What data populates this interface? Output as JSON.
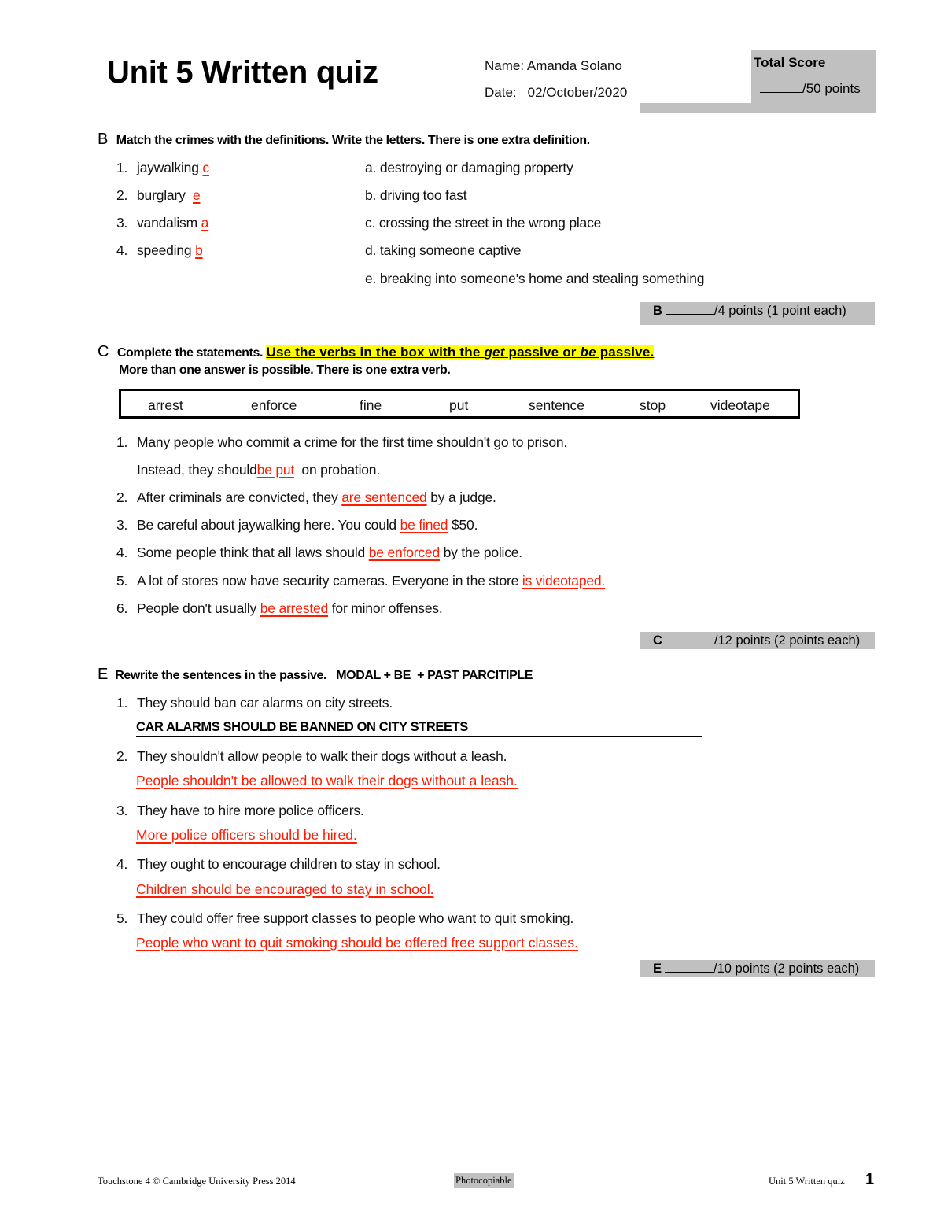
{
  "header": {
    "title": "Unit 5 Written quiz",
    "name_label": "Name:",
    "name_value": "Amanda Solano",
    "date_label": "Date:",
    "date_value": "02/October/2020",
    "total_score_label": "Total Score",
    "total_score_points": "/50 points"
  },
  "section_b": {
    "letter": "B",
    "instructions": "Match the crimes with the definitions. Write the letters. There is one extra definition.",
    "crimes": [
      {
        "num": "1.",
        "text": "jaywalking",
        "answer": "c"
      },
      {
        "num": "2.",
        "text": "burglary",
        "answer": "e"
      },
      {
        "num": "3.",
        "text": "vandalism",
        "answer": "a"
      },
      {
        "num": "4.",
        "text": "speeding",
        "answer": "b"
      }
    ],
    "definitions": [
      "a. destroying or damaging property",
      "b. driving too fast",
      "c. crossing the street in the wrong place",
      "d. taking someone captive",
      "e. breaking into someone's home and stealing something"
    ],
    "points_letter": "B",
    "points_text": "/4 points (1 point each)"
  },
  "section_c": {
    "letter": "C",
    "instructions_plain": "Complete the statements.",
    "instructions_hl_1": "Use the verbs in the box with the ",
    "instructions_hl_get": "get",
    "instructions_hl_2": " passive or ",
    "instructions_hl_be": "be",
    "instructions_hl_3": " passive.",
    "instructions_line2": "More than one answer is possible. There is one extra verb.",
    "verbs": [
      "arrest",
      "enforce",
      "fine",
      "put",
      "sentence",
      "stop",
      "videotape"
    ],
    "items": [
      {
        "num": "1.",
        "line1": "Many people who commit a crime for the first time shouldn't go to prison.",
        "before": "Instead, they should",
        "answer": "be put",
        "after": "  on probation."
      },
      {
        "num": "2.",
        "before": "After criminals are convicted, they ",
        "answer": "are sentenced",
        "after": " by a judge."
      },
      {
        "num": "3.",
        "before": "Be careful about jaywalking here. You could ",
        "answer": "be fined",
        "after": " $50."
      },
      {
        "num": "4.",
        "before": "Some people think that all laws should ",
        "answer": "be enforced",
        "after": " by the police."
      },
      {
        "num": "5.",
        "before": "A lot of stores now have security cameras. Everyone in the store ",
        "answer": "is videotaped.",
        "after": ""
      },
      {
        "num": "6.",
        "before": "People don't usually ",
        "answer": "be arrested",
        "after": " for minor offenses."
      }
    ],
    "points_letter": "C",
    "points_text": "/12 points (2 points each)"
  },
  "section_e": {
    "letter": "E",
    "instructions": "Rewrite the sentences in the passive.   MODAL + BE  + PAST PARCITIPLE",
    "items": [
      {
        "num": "1.",
        "prompt": "They should ban car alarms on city streets.",
        "answer": "CAR ALARMS SHOULD BE BANNED ON CITY STREETS"
      },
      {
        "num": "2.",
        "prompt": "They shouldn't allow people to walk their dogs without a leash.",
        "answer": "People shouldn't be allowed to walk their dogs without a leash."
      },
      {
        "num": "3.",
        "prompt": "They have to hire more police officers.",
        "answer": "More police officers should be hired."
      },
      {
        "num": "4.",
        "prompt": "They ought to encourage children to stay in school.",
        "answer": "Children should be encouraged to stay in school."
      },
      {
        "num": "5.",
        "prompt": "They could offer free support classes to people who want to quit smoking.",
        "answer": "People who want to quit smoking should be offered free support classes."
      }
    ],
    "points_letter": "E",
    "points_text": "/10 points (2 points each)"
  },
  "footer": {
    "copyright": "Touchstone 4 © Cambridge University Press 2014",
    "photocopiable": "Photocopiable",
    "running_title": "Unit 5 Written quiz",
    "page_number": "1"
  },
  "colors": {
    "answer_red": "#ff1a00",
    "score_gray": "#c0c0c0",
    "highlight_yellow": "#ffff00"
  }
}
